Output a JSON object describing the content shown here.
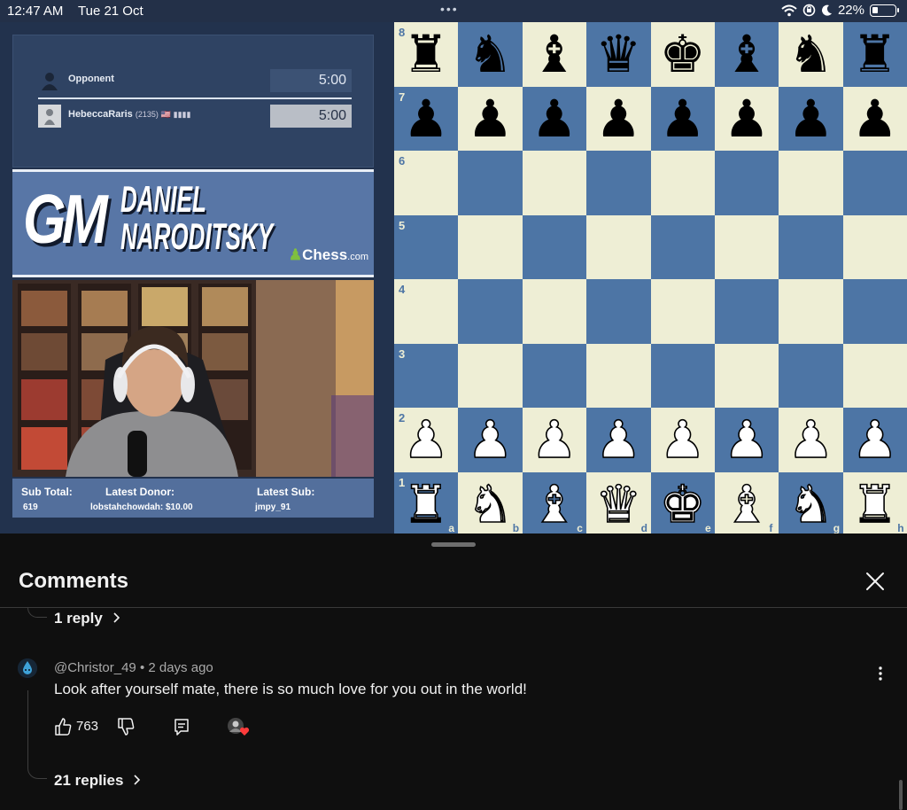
{
  "status_bar": {
    "time": "12:47 AM",
    "date": "Tue 21 Oct",
    "multitask_dots": "•••",
    "battery": "22%",
    "icons": [
      "wifi-icon",
      "orientation-lock-icon",
      "moon-icon",
      "battery-icon"
    ]
  },
  "video": {
    "players": {
      "top_name": "Opponent",
      "top_clock": "5:00",
      "bottom_name": "HebeccaRaris",
      "bottom_rating": "(2135)",
      "bottom_flag": "🇺🇸 ▮▮▮▮",
      "bottom_clock": "5:00"
    },
    "banner": {
      "gm": "GM",
      "first": "DANIEL",
      "last": "NARODITSKY",
      "brand": "Chess",
      "brand_suffix": ".com"
    },
    "sub_bar": {
      "sub_total_label": "Sub Total:",
      "sub_total_value": "619",
      "donor_label": "Latest Donor:",
      "donor_value": "lobstahchowdah: $10.00",
      "sub_label": "Latest Sub:",
      "sub_value": "jmpy_91"
    },
    "board": {
      "ranks": [
        "8",
        "7",
        "6",
        "5",
        "4",
        "3",
        "2",
        "1"
      ],
      "files": [
        "a",
        "b",
        "c",
        "d",
        "e",
        "f",
        "g",
        "h"
      ],
      "back_rank_black": [
        "♜",
        "♞",
        "♝",
        "♛",
        "♚",
        "♝",
        "♞",
        "♜"
      ],
      "pawn_black": "♟",
      "back_rank_white": [
        "♜",
        "♞",
        "♝",
        "♛",
        "♚",
        "♝",
        "♞",
        "♜"
      ],
      "pawn_white": "♟"
    }
  },
  "comments": {
    "title": "Comments",
    "prev_replies": "1 reply",
    "author": "@Christor_49",
    "age": "2 days ago",
    "text": "Look after yourself mate, there is so much love for you out in the world!",
    "likes": "763",
    "replies": "21 replies"
  }
}
